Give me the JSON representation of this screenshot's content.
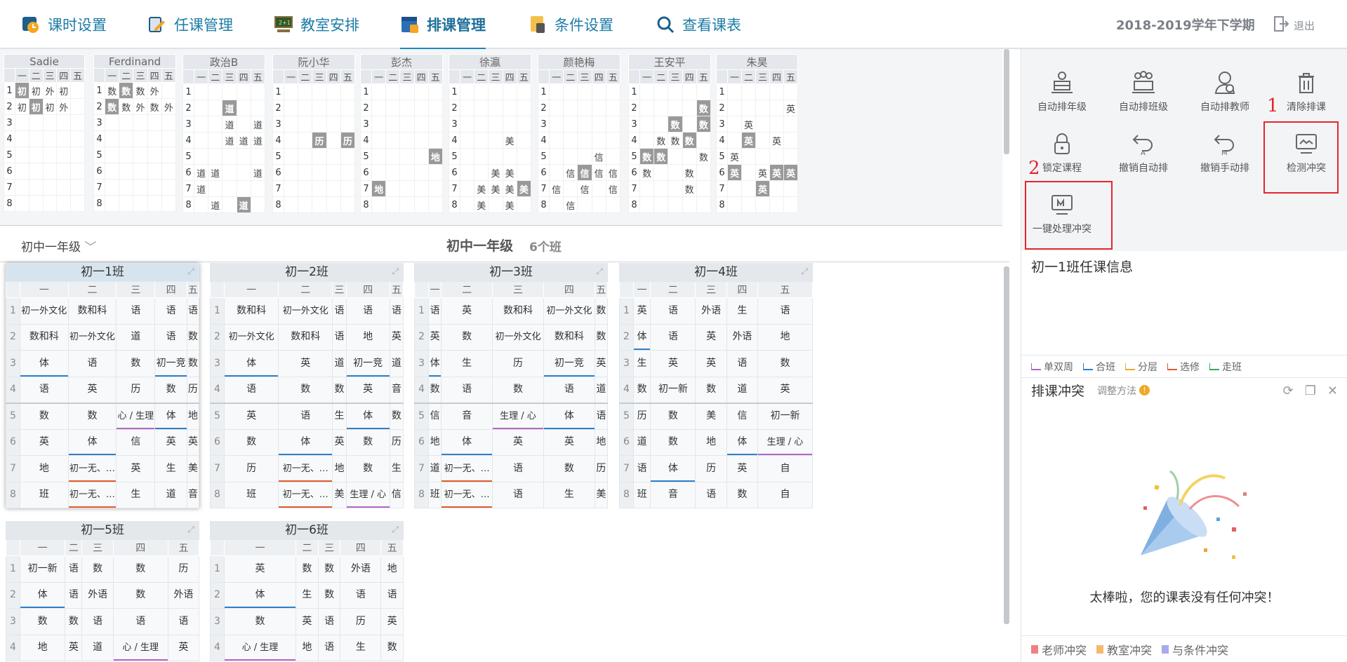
{
  "nav": {
    "tabs": [
      {
        "label": "课时设置",
        "icon": "clock-icon"
      },
      {
        "label": "任课管理",
        "icon": "edit-icon"
      },
      {
        "label": "教室安排",
        "icon": "classroom-icon"
      },
      {
        "label": "排课管理",
        "icon": "calendar-icon",
        "active": true
      },
      {
        "label": "条件设置",
        "icon": "condition-icon"
      },
      {
        "label": "查看课表",
        "icon": "search-icon"
      }
    ],
    "term": "2018-2019学年下学期",
    "logout": "退出"
  },
  "teacher_schedules": [
    {
      "name": "Sadie",
      "rows": [
        [
          "初",
          "初",
          "外",
          "初",
          ""
        ],
        [
          "初",
          "初",
          "初",
          "外",
          ""
        ],
        [
          "",
          "",
          "",
          "",
          ""
        ],
        [
          "",
          "",
          "",
          "",
          ""
        ],
        [
          "",
          "",
          "",
          "",
          ""
        ],
        [
          "",
          "",
          "",
          "",
          ""
        ],
        [
          "",
          "",
          "",
          "",
          ""
        ],
        [
          "",
          "",
          "",
          "",
          ""
        ]
      ],
      "shaded": [
        [
          0,
          0
        ],
        [
          1,
          1
        ]
      ]
    },
    {
      "name": "Ferdinand",
      "rows": [
        [
          "数",
          "数",
          "数",
          "外",
          ""
        ],
        [
          "数",
          "数",
          "外",
          "数",
          "外"
        ],
        [
          "",
          "",
          "",
          "",
          ""
        ],
        [
          "",
          "",
          "",
          "",
          ""
        ],
        [
          "",
          "",
          "",
          "",
          ""
        ],
        [
          "",
          "",
          "",
          "",
          ""
        ],
        [
          "",
          "",
          "",
          "",
          ""
        ],
        [
          "",
          "",
          "",
          "",
          ""
        ]
      ],
      "shaded": [
        [
          0,
          1
        ],
        [
          1,
          0
        ]
      ]
    },
    {
      "name": "政治B",
      "rows": [
        [
          "",
          "",
          "",
          "",
          ""
        ],
        [
          "",
          "",
          "道",
          "",
          ""
        ],
        [
          "",
          "",
          "道",
          "",
          "道"
        ],
        [
          "",
          "",
          "道",
          "道",
          "道"
        ],
        [
          "",
          "",
          "",
          "",
          ""
        ],
        [
          "道",
          "道",
          "",
          "",
          "道"
        ],
        [
          "道",
          "",
          "",
          "",
          ""
        ],
        [
          "",
          "道",
          "",
          "道",
          ""
        ]
      ],
      "shaded": [
        [
          1,
          2
        ],
        [
          7,
          3
        ]
      ]
    },
    {
      "name": "阮小华",
      "rows": [
        [
          "",
          "",
          "",
          "",
          ""
        ],
        [
          "",
          "",
          "",
          "",
          ""
        ],
        [
          "",
          "",
          "",
          "",
          ""
        ],
        [
          "",
          "",
          "历",
          "",
          "历"
        ],
        [
          "",
          "",
          "",
          "",
          ""
        ],
        [
          "",
          "",
          "",
          "",
          ""
        ],
        [
          "",
          "",
          "",
          "",
          ""
        ],
        [
          "",
          "",
          "",
          "",
          ""
        ]
      ],
      "shaded": [
        [
          3,
          2
        ],
        [
          3,
          4
        ]
      ]
    },
    {
      "name": "彭杰",
      "rows": [
        [
          "",
          "",
          "",
          "",
          ""
        ],
        [
          "",
          "",
          "",
          "",
          ""
        ],
        [
          "",
          "",
          "",
          "",
          ""
        ],
        [
          "",
          "",
          "",
          "",
          ""
        ],
        [
          "",
          "",
          "",
          "",
          "地"
        ],
        [
          "",
          "",
          "",
          "",
          ""
        ],
        [
          "地",
          "",
          "",
          "",
          ""
        ],
        [
          "",
          "",
          "",
          "",
          ""
        ]
      ],
      "shaded": [
        [
          4,
          4
        ],
        [
          6,
          0
        ]
      ]
    },
    {
      "name": "徐瀛",
      "rows": [
        [
          "",
          "",
          "",
          "",
          ""
        ],
        [
          "",
          "",
          "",
          "",
          ""
        ],
        [
          "",
          "",
          "",
          "",
          ""
        ],
        [
          "",
          "",
          "",
          "美",
          ""
        ],
        [
          "",
          "",
          "",
          "",
          ""
        ],
        [
          "",
          "",
          "美",
          "美",
          ""
        ],
        [
          "",
          "美",
          "美",
          "美",
          "美"
        ],
        [
          "",
          "美",
          "",
          "美",
          ""
        ]
      ],
      "shaded": [
        [
          6,
          4
        ]
      ]
    },
    {
      "name": "颜艳梅",
      "rows": [
        [
          "",
          "",
          "",
          "",
          ""
        ],
        [
          "",
          "",
          "",
          "",
          ""
        ],
        [
          "",
          "",
          "",
          "",
          ""
        ],
        [
          "",
          "",
          "",
          "",
          ""
        ],
        [
          "",
          "",
          "",
          "信",
          ""
        ],
        [
          "",
          "信",
          "信",
          "信",
          "信"
        ],
        [
          "信",
          "",
          "信",
          "",
          "信"
        ],
        [
          "",
          "信",
          "",
          "",
          ""
        ]
      ],
      "shaded": [
        [
          5,
          2
        ]
      ]
    },
    {
      "name": "王安平",
      "rows": [
        [
          "",
          "",
          "",
          "",
          ""
        ],
        [
          "",
          "",
          "",
          "",
          "数"
        ],
        [
          "",
          "",
          "数",
          "",
          "数"
        ],
        [
          "",
          "数",
          "数",
          "数",
          ""
        ],
        [
          "数",
          "数",
          "",
          "",
          "数"
        ],
        [
          "数",
          "",
          "",
          "数",
          ""
        ],
        [
          "",
          "",
          "",
          "数",
          ""
        ],
        [
          "",
          "",
          "",
          "",
          ""
        ]
      ],
      "shaded": [
        [
          1,
          4
        ],
        [
          2,
          2
        ],
        [
          2,
          4
        ],
        [
          3,
          3
        ],
        [
          4,
          0
        ],
        [
          4,
          1
        ]
      ]
    },
    {
      "name": "朱昊",
      "rows": [
        [
          "",
          "",
          "",
          "",
          ""
        ],
        [
          "",
          "",
          "",
          "",
          "英"
        ],
        [
          "",
          "英",
          "",
          "",
          ""
        ],
        [
          "",
          "英",
          "",
          "英",
          ""
        ],
        [
          "英",
          "",
          "",
          "",
          ""
        ],
        [
          "英",
          "",
          "英",
          "英",
          "英"
        ],
        [
          "",
          "",
          "英",
          "",
          ""
        ],
        [
          "",
          "",
          "",
          "",
          ""
        ]
      ],
      "shaded": [
        [
          3,
          1
        ],
        [
          5,
          0
        ],
        [
          5,
          3
        ],
        [
          5,
          4
        ],
        [
          6,
          2
        ]
      ]
    }
  ],
  "weekdays": [
    "一",
    "二",
    "三",
    "四",
    "五"
  ],
  "periods": [
    "1",
    "2",
    "3",
    "4",
    "5",
    "6",
    "7",
    "8"
  ],
  "grade": {
    "selector": "初中一年级",
    "title": "初中一年级",
    "count": "6个班"
  },
  "classes": [
    {
      "name": "初一1班",
      "rows": [
        [
          "初一外文化",
          "数和科",
          "语",
          "语",
          "语"
        ],
        [
          "数和科",
          "初一外文化",
          "道",
          "语",
          "数"
        ],
        [
          "体",
          "语",
          "数",
          "初一竞",
          "数"
        ],
        [
          "语",
          "英",
          "历",
          "数",
          "历"
        ],
        [
          "数",
          "数",
          "心 / 生理",
          "体",
          "地"
        ],
        [
          "英",
          "体",
          "信",
          "英",
          "英"
        ],
        [
          "地",
          "初一无、…",
          "英",
          "生",
          "美"
        ],
        [
          "班",
          "初一无、…",
          "生",
          "道",
          "音"
        ]
      ]
    },
    {
      "name": "初一2班",
      "rows": [
        [
          "数和科",
          "初一外文化",
          "语",
          "语",
          "语"
        ],
        [
          "初一外文化",
          "数和科",
          "语",
          "地",
          "英"
        ],
        [
          "体",
          "英",
          "道",
          "初一竞",
          "道"
        ],
        [
          "语",
          "数",
          "数",
          "英",
          "音"
        ],
        [
          "英",
          "语",
          "生",
          "体",
          "数"
        ],
        [
          "数",
          "体",
          "英",
          "数",
          "历"
        ],
        [
          "历",
          "初一无、…",
          "地",
          "数",
          "生"
        ],
        [
          "班",
          "初一无、…",
          "美",
          "生理 / 心",
          "信"
        ]
      ]
    },
    {
      "name": "初一3班",
      "rows": [
        [
          "语",
          "英",
          "数和科",
          "初一外文化",
          "数"
        ],
        [
          "英",
          "数",
          "初一外文化",
          "数和科",
          "数"
        ],
        [
          "体",
          "生",
          "历",
          "初一竞",
          "英"
        ],
        [
          "数",
          "语",
          "数",
          "语",
          "道"
        ],
        [
          "信",
          "音",
          "生理 / 心",
          "体",
          "语"
        ],
        [
          "地",
          "体",
          "英",
          "英",
          "地"
        ],
        [
          "道",
          "初一无、…",
          "语",
          "数",
          "历"
        ],
        [
          "班",
          "初一无、…",
          "语",
          "生",
          "美"
        ]
      ]
    },
    {
      "name": "初一4班",
      "rows": [
        [
          "英",
          "语",
          "外语",
          "生",
          "语"
        ],
        [
          "体",
          "语",
          "英",
          "外语",
          "地"
        ],
        [
          "生",
          "英",
          "英",
          "语",
          "数"
        ],
        [
          "数",
          "初一新",
          "数",
          "道",
          "英"
        ],
        [
          "历",
          "数",
          "美",
          "信",
          "初一新"
        ],
        [
          "道",
          "数",
          "地",
          "体",
          "生理 / 心"
        ],
        [
          "语",
          "体",
          "历",
          "英",
          "自"
        ],
        [
          "班",
          "音",
          "语",
          "数",
          "自"
        ]
      ]
    },
    {
      "name": "初一5班",
      "rows": [
        [
          "初一新",
          "语",
          "数",
          "数",
          "历"
        ],
        [
          "体",
          "语",
          "外语",
          "数",
          "外语"
        ],
        [
          "数",
          "数",
          "语",
          "语",
          "语"
        ],
        [
          "地",
          "英",
          "道",
          "心 / 生理",
          "英"
        ]
      ]
    },
    {
      "name": "初一6班",
      "rows": [
        [
          "英",
          "数",
          "数",
          "外语",
          "地"
        ],
        [
          "体",
          "生",
          "数",
          "语",
          "语"
        ],
        [
          "数",
          "英",
          "语",
          "历",
          "英"
        ],
        [
          "心 / 生理",
          "地",
          "语",
          "生",
          "数"
        ]
      ]
    }
  ],
  "actions": [
    {
      "label": "自动排年级",
      "icon": "auto-grade-icon"
    },
    {
      "label": "自动排班级",
      "icon": "auto-class-icon"
    },
    {
      "label": "自动排教师",
      "icon": "auto-teacher-icon"
    },
    {
      "label": "清除排课",
      "icon": "trash-icon"
    },
    {
      "label": "锁定课程",
      "icon": "lock-icon"
    },
    {
      "label": "撤销自动排",
      "icon": "undo-auto-icon"
    },
    {
      "label": "撤销手动排",
      "icon": "undo-manual-icon"
    },
    {
      "label": "检测冲突",
      "icon": "monitor-check-icon"
    },
    {
      "label": "一键处理冲突",
      "icon": "monitor-fix-icon"
    }
  ],
  "annotations": {
    "step1": "1",
    "step2": "2"
  },
  "info_title": "初一1班任课信息",
  "legend1": [
    {
      "label": "单双周",
      "color": "#b466c4"
    },
    {
      "label": "合班",
      "color": "#2f80c8"
    },
    {
      "label": "分层",
      "color": "#f0a828"
    },
    {
      "label": "选修",
      "color": "#e05b2b"
    },
    {
      "label": "走班",
      "color": "#3aa860"
    }
  ],
  "conflict": {
    "title": "排课冲突",
    "method": "调整方法",
    "info": "!",
    "message": "太棒啦，您的课表没有任何冲突！"
  },
  "legend2": [
    {
      "label": "老师冲突",
      "color": "#f08080"
    },
    {
      "label": "教室冲突",
      "color": "#f5b96a"
    },
    {
      "label": "与条件冲突",
      "color": "#a9a9ee"
    }
  ]
}
